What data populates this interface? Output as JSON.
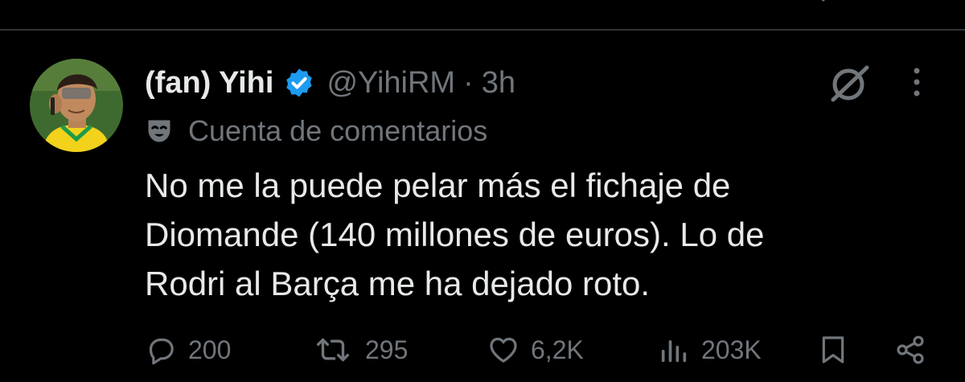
{
  "tweet": {
    "author": {
      "display_name": "(fan) Yihi",
      "verified": true,
      "handle": "@YihiRM",
      "separator": "·",
      "time": "3h",
      "account_label": "Cuenta de comentarios"
    },
    "text": "No me la puede pelar más el fichaje de\nDiomande (140 millones de euros). Lo de\nRodri al Barça me ha dejado roto.",
    "actions": {
      "replies": "200",
      "reposts": "295",
      "likes": "6,2K",
      "views": "203K"
    }
  },
  "colors": {
    "background": "#000000",
    "text_primary": "#e7e9ea",
    "text_secondary": "#71767b",
    "verified_blue": "#1d9bf0",
    "divider": "#2f3336"
  },
  "icons": {
    "verified": "verified-badge-icon",
    "account_label": "mask-icon",
    "grok": "grok-icon",
    "more": "more-icon",
    "reply": "reply-icon",
    "repost": "repost-icon",
    "like": "like-icon",
    "views": "views-icon",
    "bookmark": "bookmark-icon",
    "share": "share-icon"
  }
}
